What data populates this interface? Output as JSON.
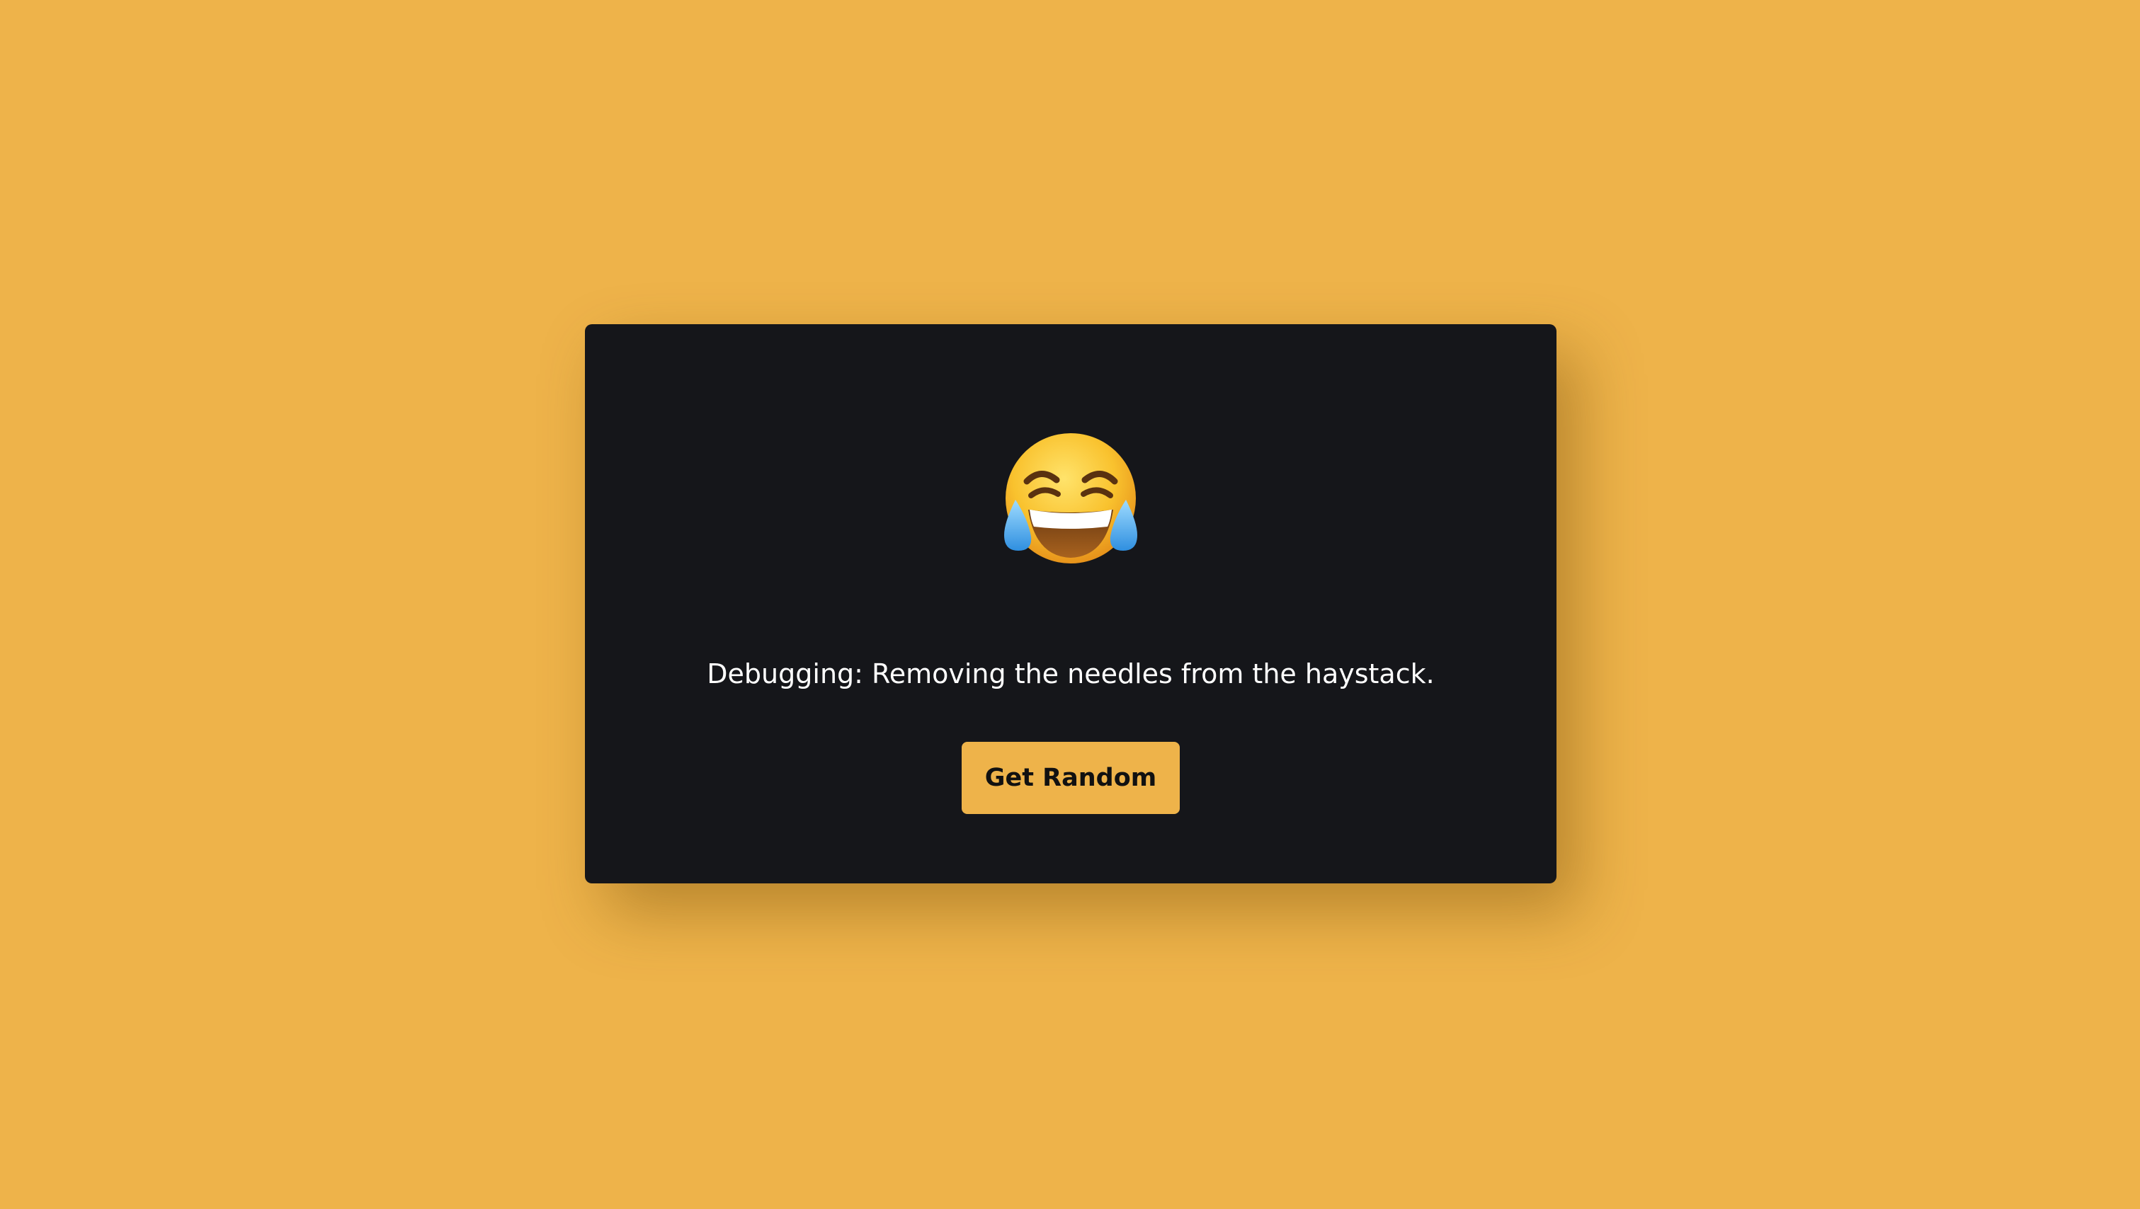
{
  "emoji": {
    "icon": "face-with-tears-of-joy-icon"
  },
  "joke": {
    "text": "Debugging: Removing the needles from the haystack."
  },
  "actions": {
    "get_random_label": "Get Random"
  },
  "colors": {
    "background": "#EEB34A",
    "card": "#15161A",
    "button": "#EEB34A",
    "button_text": "#111111",
    "text": "#FFFFFF"
  }
}
